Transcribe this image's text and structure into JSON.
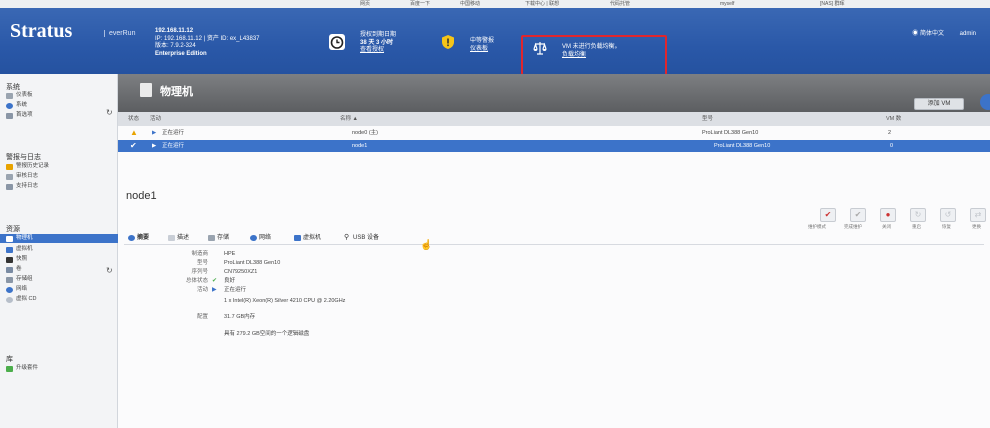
{
  "bookmarks": [
    "网页",
    "百度一下",
    "中国移动",
    "下载中心 | 联想",
    "代码托管",
    "myself",
    "[NAS] 群晖"
  ],
  "header": {
    "logo": "Stratus",
    "logo_sub": "everRun",
    "ip_main": "192.168.11.12",
    "ip_line": "IP: 192.168.11.12 | 资产 ID: ex_L43837",
    "version": "版本: 7.9.2-324",
    "edition": "Enterprise Edition",
    "license_l1": "授权到期日期",
    "license_l2": "38 天 3 小时",
    "license_l3": "查看授权",
    "alarm_l1": "中等警报",
    "alarm_l2": "仪表板",
    "vm_l1": "VM 未进行负载均衡。",
    "vm_l2": "负载均衡",
    "lang": "简体中文",
    "user": "admin"
  },
  "sidebar": {
    "group1": "系统",
    "dashboard": "仪表板",
    "system": "系统",
    "prefs": "首选项",
    "group2": "警报与日志",
    "alarm_history": "警报历史记录",
    "audit_log": "审核日志",
    "support_log": "支持日志",
    "group3": "资源",
    "physical": "物理机",
    "vms": "虚拟机",
    "snapshots": "快照",
    "volumes": "卷",
    "storage_groups": "存储组",
    "networks": "网络",
    "virtual_cds": "虚拟 CD",
    "group4": "库",
    "upgrade": "升级套件"
  },
  "main": {
    "title": "物理机",
    "add_vm": "添加 VM",
    "col_status": "状态",
    "col_activity": "活动",
    "col_name": "名称 ▲",
    "col_model": "型号",
    "col_vms": "VM 数",
    "rows": [
      {
        "activity": "正在运行",
        "name": "node0 (主)",
        "model": "ProLiant DL388 Gen10",
        "vms": "2"
      },
      {
        "activity": "正在运行",
        "name": "node1",
        "model": "ProLiant DL388 Gen10",
        "vms": "0"
      }
    ],
    "node_title": "node1",
    "actions": [
      "维护模式",
      "完成维护",
      "关闭",
      "重启",
      "恢复",
      "更换"
    ],
    "tabs": [
      "摘要",
      "描述",
      "存储",
      "网络",
      "虚拟机",
      "USB 设备"
    ],
    "details": {
      "mfr_label": "制造商",
      "mfr": "HPE",
      "model_label": "型号",
      "model": "ProLiant DL388 Gen10",
      "serial_label": "序列号",
      "serial": "CN79250XZ1",
      "state_label": "总体状态",
      "state": "良好",
      "activity_label": "活动",
      "activity": "正在运行",
      "cpu": "1 x Intel(R) Xeon(R) Silver 4210 CPU @ 2.20GHz",
      "config_label": "配置",
      "memory": "31.7 GB内存",
      "disk": "具有 279.2 GB空间的一个逻辑磁盘"
    }
  }
}
